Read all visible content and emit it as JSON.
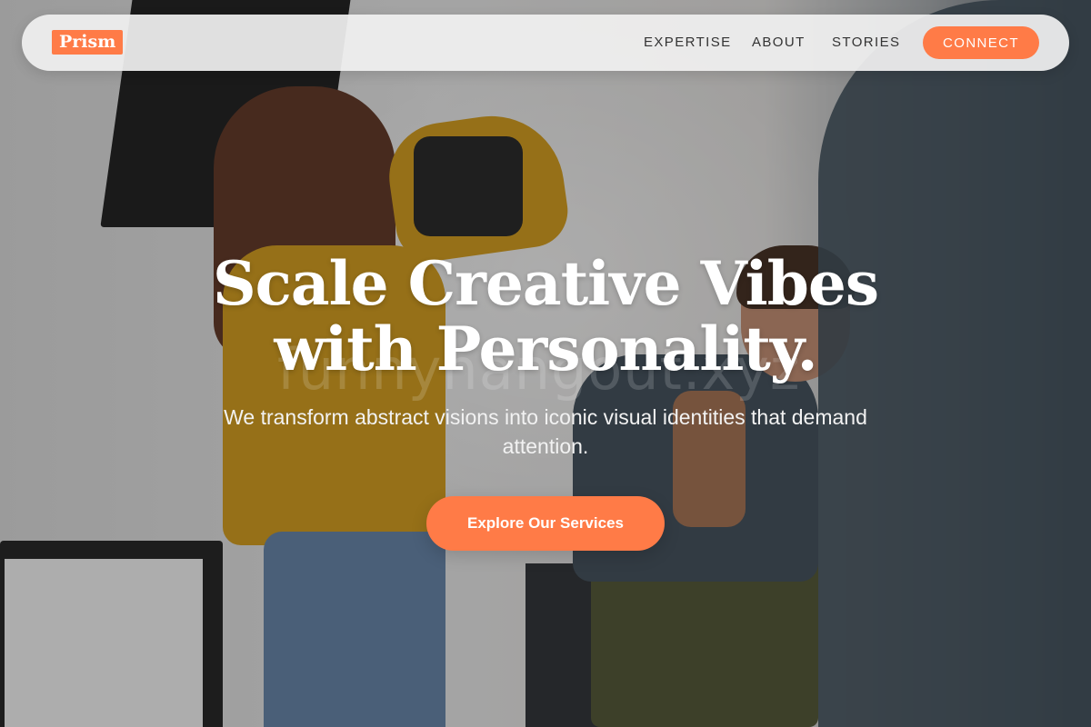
{
  "brand": {
    "logo_text": "Prism"
  },
  "nav": {
    "links": [
      "EXPERTISE",
      "ABOUT",
      "STORIES"
    ],
    "connect_label": "CONNECT"
  },
  "hero": {
    "title": "Scale Creative Vibes with Personality.",
    "subtitle": "We transform abstract visions into iconic visual identities that demand attention.",
    "cta_label": "Explore Our Services",
    "watermark": "funnyhangout.xyz",
    "background_icon": "photo-studio-shoot-image"
  },
  "colors": {
    "accent": "#ff7b47",
    "nav_background": "#f0f0f0",
    "text_light": "#ffffff",
    "nav_text": "#333333"
  }
}
